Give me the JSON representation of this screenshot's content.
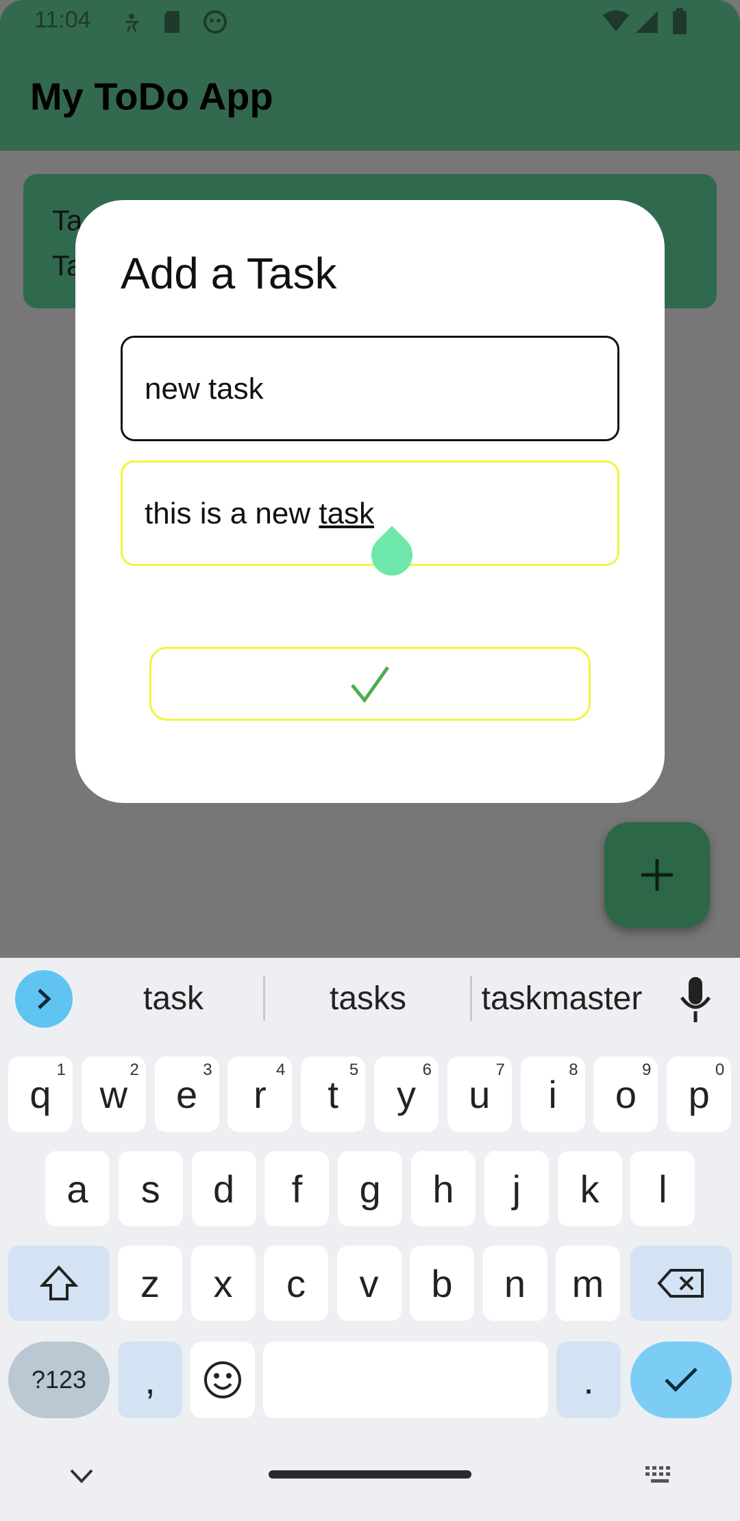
{
  "status_bar": {
    "time": "11:04"
  },
  "app_bar": {
    "title": "My ToDo App"
  },
  "list": {
    "card_line1": "Ta",
    "card_line2": "Ta"
  },
  "dialog": {
    "title": "Add a Task",
    "title_field_value": "new task",
    "description_prefix": "this is a new ",
    "description_underlined": "task"
  },
  "colors": {
    "primary": "#33694f",
    "fab": "#2c6748",
    "field_focus": "#f1f53a",
    "check": "#4caf50"
  },
  "icons": {
    "confirm": "check-icon",
    "fab": "plus-icon"
  },
  "keyboard": {
    "suggestions": [
      "task",
      "tasks",
      "taskmaster"
    ],
    "row1": [
      {
        "k": "q",
        "h": "1"
      },
      {
        "k": "w",
        "h": "2"
      },
      {
        "k": "e",
        "h": "3"
      },
      {
        "k": "r",
        "h": "4"
      },
      {
        "k": "t",
        "h": "5"
      },
      {
        "k": "y",
        "h": "6"
      },
      {
        "k": "u",
        "h": "7"
      },
      {
        "k": "i",
        "h": "8"
      },
      {
        "k": "o",
        "h": "9"
      },
      {
        "k": "p",
        "h": "0"
      }
    ],
    "row2": [
      "a",
      "s",
      "d",
      "f",
      "g",
      "h",
      "j",
      "k",
      "l"
    ],
    "row3": [
      "z",
      "x",
      "c",
      "v",
      "b",
      "n",
      "m"
    ],
    "sym_label": "?123",
    "comma": ",",
    "period": "."
  }
}
